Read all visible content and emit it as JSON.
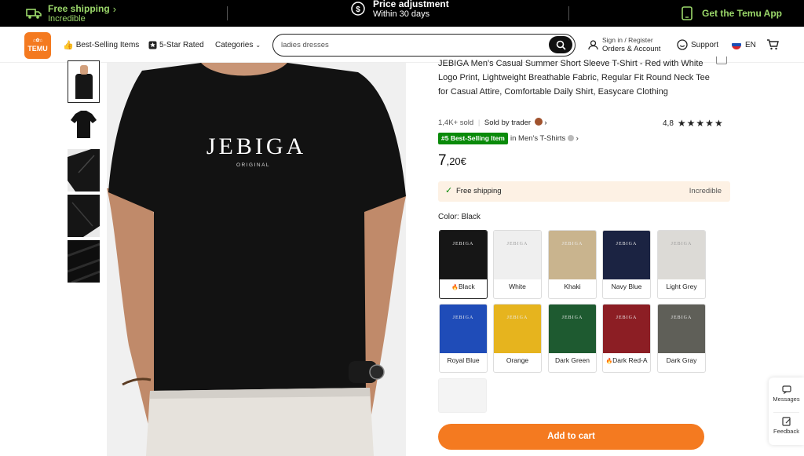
{
  "promo": {
    "free_shipping": "Free shipping",
    "free_shipping_sub": "Incredible",
    "price_adj": "Price adjustment",
    "price_adj_sub": "Within 30 days",
    "app": "Get the Temu App"
  },
  "nav": {
    "logo": "TEMU",
    "best_selling": "Best-Selling Items",
    "five_star": "5-Star Rated",
    "categories": "Categories",
    "search_value": "ladies dresses",
    "signin": "Sign in / Register",
    "orders": "Orders & Account",
    "support": "Support",
    "lang": "EN"
  },
  "product": {
    "title": "JEBIGA Men's Casual Summer Short Sleeve T-Shirt - Red with White Logo Print, Lightweight Breathable Fabric, Regular Fit Round Neck Tee for Casual Attire, Comfortable Daily Shirt, Easycare Clothing",
    "sold": "1,4K+ sold",
    "sold_by": "Sold by trader",
    "rating": "4,8",
    "badge": "#5 Best-Selling Item",
    "category": "in Men's T-Shirts",
    "price_main": "7",
    "price_dec": ",20€",
    "shipping": "Free shipping",
    "shipping_right": "Incredible",
    "color_label": "Color: Black",
    "brand": "JEBIGA",
    "brand_sub": "ORIGINAL",
    "add_to_cart": "Add to cart"
  },
  "swatches": [
    {
      "label": "Black",
      "color": "#161616",
      "hot": true
    },
    {
      "label": "White",
      "color": "#efefef",
      "hot": false
    },
    {
      "label": "Khaki",
      "color": "#c9b48e",
      "hot": false
    },
    {
      "label": "Navy Blue",
      "color": "#1b2342",
      "hot": false
    },
    {
      "label": "Light Grey",
      "color": "#dcdad6",
      "hot": false
    },
    {
      "label": "Royal Blue",
      "color": "#1f4cb8",
      "hot": false
    },
    {
      "label": "Orange",
      "color": "#e6b41e",
      "hot": false
    },
    {
      "label": "Dark Green",
      "color": "#1e5a30",
      "hot": false
    },
    {
      "label": "Dark Red-A",
      "color": "#8c1e24",
      "hot": true
    },
    {
      "label": "Dark Gray",
      "color": "#5f5f58",
      "hot": false
    }
  ],
  "side": {
    "messages": "Messages",
    "feedback": "Feedback"
  },
  "colors": {
    "accent": "#f47a20",
    "promo_green": "#9bd86a",
    "badge_green": "#0a8a0a"
  }
}
